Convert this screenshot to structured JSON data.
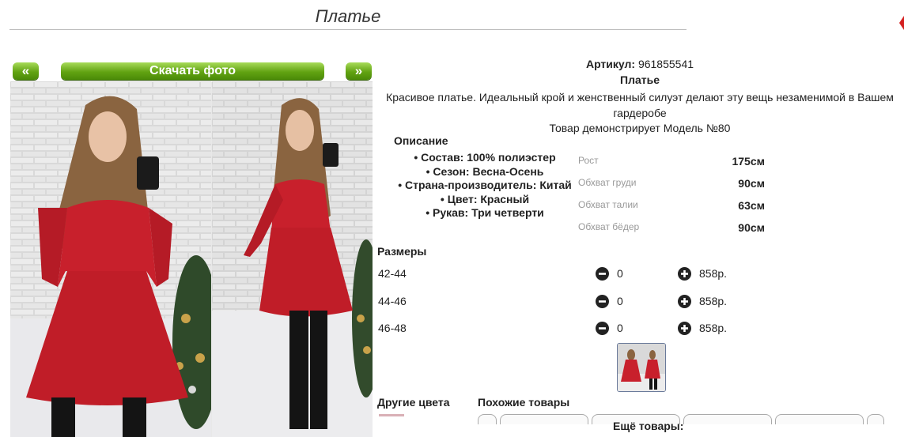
{
  "page": {
    "title": "Платье"
  },
  "gallery": {
    "prev_label": "«",
    "download_label": "Скачать фото",
    "next_label": "»"
  },
  "product": {
    "article_label": "Артикул:",
    "article_value": "961855541",
    "name": "Платье",
    "description": "Красивое платье. Идеальный крой и женственный силуэт делают эту вещь незаменимой в Вашем гардеробе",
    "model_note": "Товар демонстрирует Модель №80"
  },
  "description": {
    "label": "Описание",
    "items": [
      "Состав: 100% полиэстер",
      "Сезон: Весна-Осень",
      "Страна-производитель: Китай",
      "Цвет: Красный",
      "Рукав: Три четверти"
    ]
  },
  "measurements": [
    {
      "label": "Рост",
      "value": "175см"
    },
    {
      "label": "Обхват груди",
      "value": "90см"
    },
    {
      "label": "Обхват талии",
      "value": "63см"
    },
    {
      "label": "Обхват бёдер",
      "value": "90см"
    }
  ],
  "sizes": {
    "label": "Размеры",
    "rows": [
      {
        "size": "42-44",
        "qty": "0",
        "price": "858р."
      },
      {
        "size": "44-46",
        "qty": "0",
        "price": "858р."
      },
      {
        "size": "46-48",
        "qty": "0",
        "price": "858р."
      }
    ]
  },
  "footer": {
    "other_colors_label": "Другие цвета",
    "similar_label": "Похожие товары",
    "more_label": "Ещё товары:"
  },
  "colors": {
    "accent_green": "#62a312",
    "dress_red": "#c8202c"
  }
}
